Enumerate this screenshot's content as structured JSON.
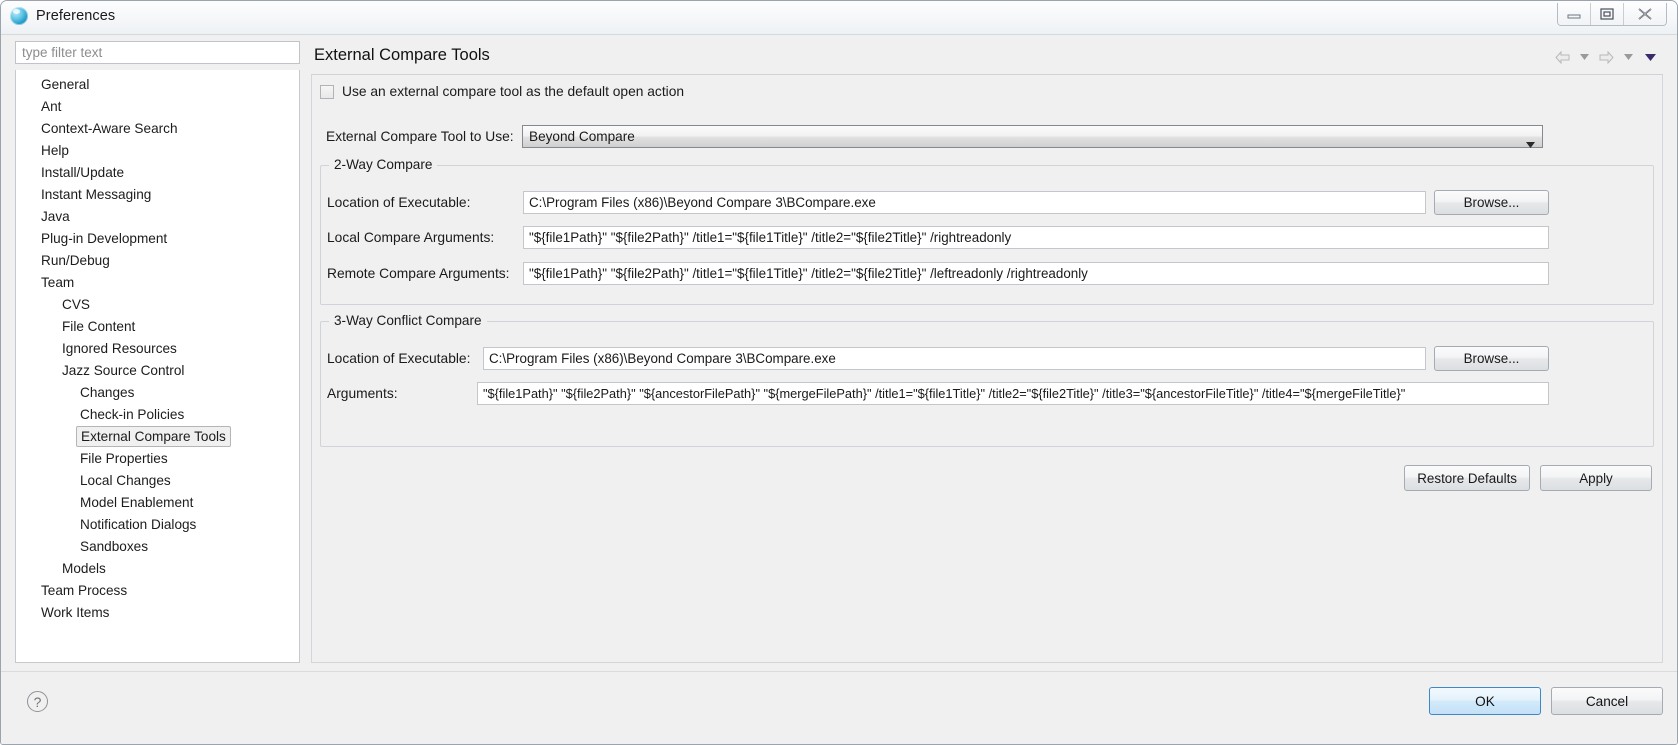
{
  "window": {
    "title": "Preferences",
    "icon": "globe-icon",
    "controls": {
      "minimize": "Minimize",
      "restore": "Restore",
      "close": "Close"
    }
  },
  "sidebar": {
    "filter_placeholder": "type filter text",
    "filter_value": "",
    "selected": "External Compare Tools",
    "items": [
      {
        "label": "General",
        "level": 1
      },
      {
        "label": "Ant",
        "level": 1
      },
      {
        "label": "Context-Aware Search",
        "level": 1
      },
      {
        "label": "Help",
        "level": 1
      },
      {
        "label": "Install/Update",
        "level": 1
      },
      {
        "label": "Instant Messaging",
        "level": 1
      },
      {
        "label": "Java",
        "level": 1
      },
      {
        "label": "Plug-in Development",
        "level": 1
      },
      {
        "label": "Run/Debug",
        "level": 1
      },
      {
        "label": "Team",
        "level": 1
      },
      {
        "label": "CVS",
        "level": 2
      },
      {
        "label": "File Content",
        "level": 2
      },
      {
        "label": "Ignored Resources",
        "level": 2
      },
      {
        "label": "Jazz Source Control",
        "level": 2
      },
      {
        "label": "Changes",
        "level": 3
      },
      {
        "label": "Check-in Policies",
        "level": 3
      },
      {
        "label": "External Compare Tools",
        "level": 3
      },
      {
        "label": "File Properties",
        "level": 3
      },
      {
        "label": "Local Changes",
        "level": 3
      },
      {
        "label": "Model Enablement",
        "level": 3
      },
      {
        "label": "Notification Dialogs",
        "level": 3
      },
      {
        "label": "Sandboxes",
        "level": 3
      },
      {
        "label": "Models",
        "level": 2
      },
      {
        "label": "Team Process",
        "level": 1
      },
      {
        "label": "Work Items",
        "level": 1
      }
    ]
  },
  "page": {
    "title": "External Compare Tools",
    "nav": {
      "back": "back-arrow",
      "back_menu": "back-dropdown",
      "forward": "forward-arrow",
      "forward_menu": "forward-dropdown",
      "view_menu": "view-menu-dropdown"
    },
    "default_open_action": {
      "label": "Use an external compare tool as the default open action",
      "checked": false
    },
    "tool_selector": {
      "label": "External Compare Tool to Use:",
      "value": "Beyond Compare"
    },
    "two_way": {
      "title": "2-Way Compare",
      "executable_label": "Location of Executable:",
      "executable_value": "C:\\Program Files (x86)\\Beyond Compare 3\\BCompare.exe",
      "browse_label": "Browse...",
      "local_args_label": "Local Compare Arguments:",
      "local_args_value": "\"${file1Path}\" \"${file2Path}\" /title1=\"${file1Title}\" /title2=\"${file2Title}\" /rightreadonly",
      "remote_args_label": "Remote Compare Arguments:",
      "remote_args_value": "\"${file1Path}\" \"${file2Path}\" /title1=\"${file1Title}\" /title2=\"${file2Title}\" /leftreadonly /rightreadonly"
    },
    "three_way": {
      "title": "3-Way Conflict Compare",
      "executable_label": "Location of Executable:",
      "executable_value": "C:\\Program Files (x86)\\Beyond Compare 3\\BCompare.exe",
      "browse_label": "Browse...",
      "args_label": "Arguments:",
      "args_value": "\"${file1Path}\" \"${file2Path}\" \"${ancestorFilePath}\" \"${mergeFilePath}\" /title1=\"${file1Title}\" /title2=\"${file2Title}\" /title3=\"${ancestorFileTitle}\" /title4=\"${mergeFileTitle}\""
    },
    "restore_defaults_label": "Restore Defaults",
    "apply_label": "Apply"
  },
  "footer": {
    "help_icon": "help-question-icon",
    "ok_label": "OK",
    "cancel_label": "Cancel"
  },
  "colors": {
    "dialog_bg": "#f0f0f0",
    "accent_ok": "#3c88c8",
    "text": "#1a1a1a",
    "menu_arrow": "#3b2a6b"
  }
}
